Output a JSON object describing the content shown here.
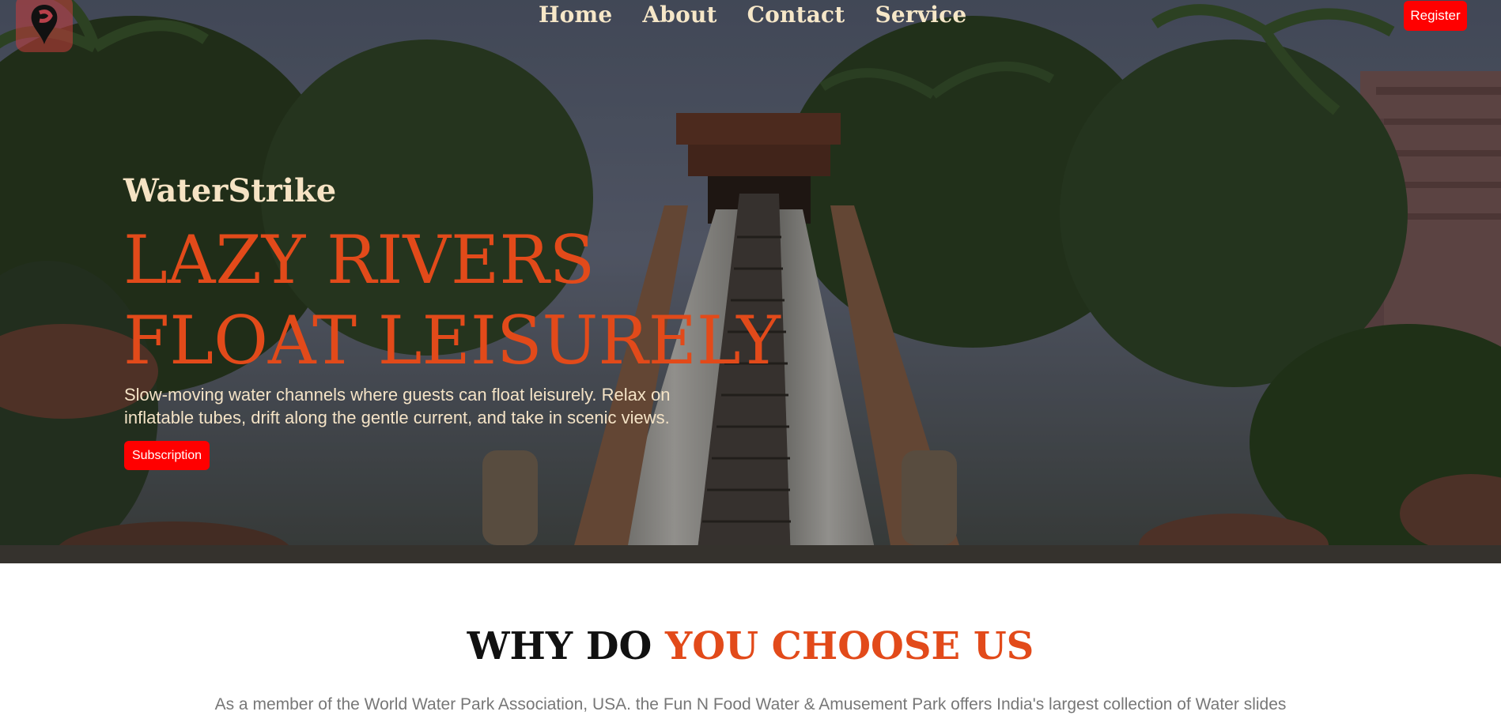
{
  "header": {
    "logo_icon": "location-pin-icon",
    "nav": [
      {
        "label": "Home"
      },
      {
        "label": "About"
      },
      {
        "label": "Contact"
      },
      {
        "label": "Service"
      }
    ],
    "register_label": "Register"
  },
  "hero": {
    "brand": "WaterStrike",
    "headline_line1": "LAZY RIVERS",
    "headline_line2": "FLOAT LEISURELY",
    "description": "Slow-moving water channels where guests can float leisurely. Relax on inflatable tubes, drift along the gentle current, and take in scenic views.",
    "subscribe_label": "Subscription"
  },
  "why": {
    "title_dark": "WHY DO",
    "title_accent": "YOU CHOOSE US",
    "text": "As a member of the World Water Park Association, USA. the Fun N Food Water & Amusement Park offers India's largest collection of Water slides"
  },
  "colors": {
    "accent": "#e24a1a",
    "button": "#ff0000",
    "nav_text": "#f6e7c8"
  }
}
